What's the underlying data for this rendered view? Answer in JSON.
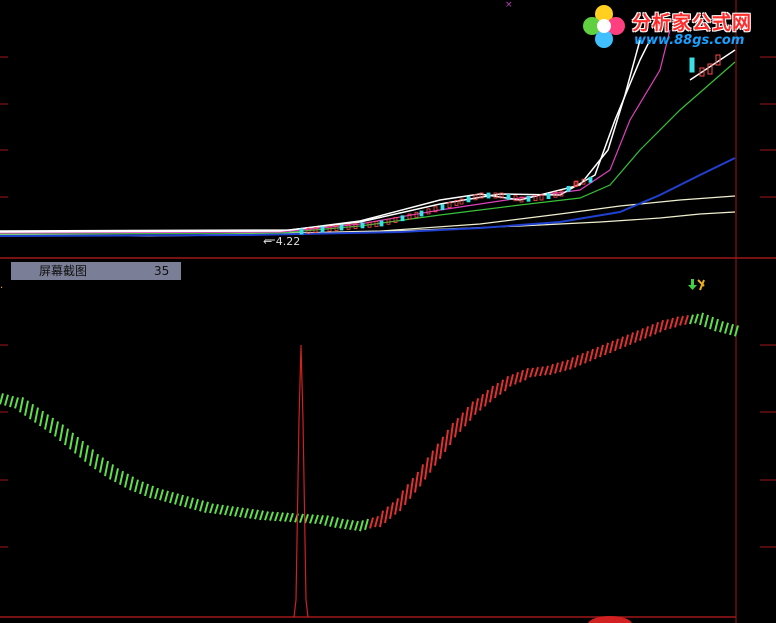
{
  "logo": {
    "name": "分析家公式网",
    "url": "www.88gs.com"
  },
  "main_panel": {
    "low_price_label": "← 4.22"
  },
  "indicator_panel": {
    "title": "屏幕截图",
    "value": "35"
  },
  "colors": {
    "background": "#000000",
    "divider": "#a01818",
    "rising": "#e03030",
    "falling": "#5ee04a",
    "candle_up": "#ff4a4a",
    "candle_down": "#38e0e8",
    "ma_white": "#ffffff",
    "ma_magenta": "#e040c0",
    "ma_green": "#38c038",
    "ma_blue": "#2040d0",
    "ma_cream": "#f0f0d0"
  },
  "chart_data": {
    "type": "line",
    "indicator_series": {
      "name": "",
      "values": [
        0.62,
        0.6,
        0.55,
        0.5,
        0.44,
        0.38,
        0.33,
        0.29,
        0.26,
        0.24,
        0.22,
        0.2,
        0.19,
        0.18,
        0.17,
        0.165,
        0.16,
        0.155,
        0.14,
        0.13,
        0.15,
        0.21,
        0.3,
        0.4,
        0.5,
        0.58,
        0.64,
        0.69,
        0.72,
        0.73,
        0.75,
        0.78,
        0.81,
        0.84,
        0.87,
        0.9,
        0.92,
        0.93,
        0.9,
        0.88
      ],
      "colors": [
        "green",
        "green",
        "green",
        "green",
        "green",
        "green",
        "green",
        "green",
        "green",
        "green",
        "green",
        "green",
        "green",
        "green",
        "green",
        "green",
        "green",
        "green",
        "green",
        "green",
        "red",
        "red",
        "red",
        "red",
        "red",
        "red",
        "red",
        "red",
        "red",
        "red",
        "red",
        "red",
        "red",
        "red",
        "red",
        "red",
        "red",
        "green",
        "green",
        "green"
      ]
    }
  }
}
